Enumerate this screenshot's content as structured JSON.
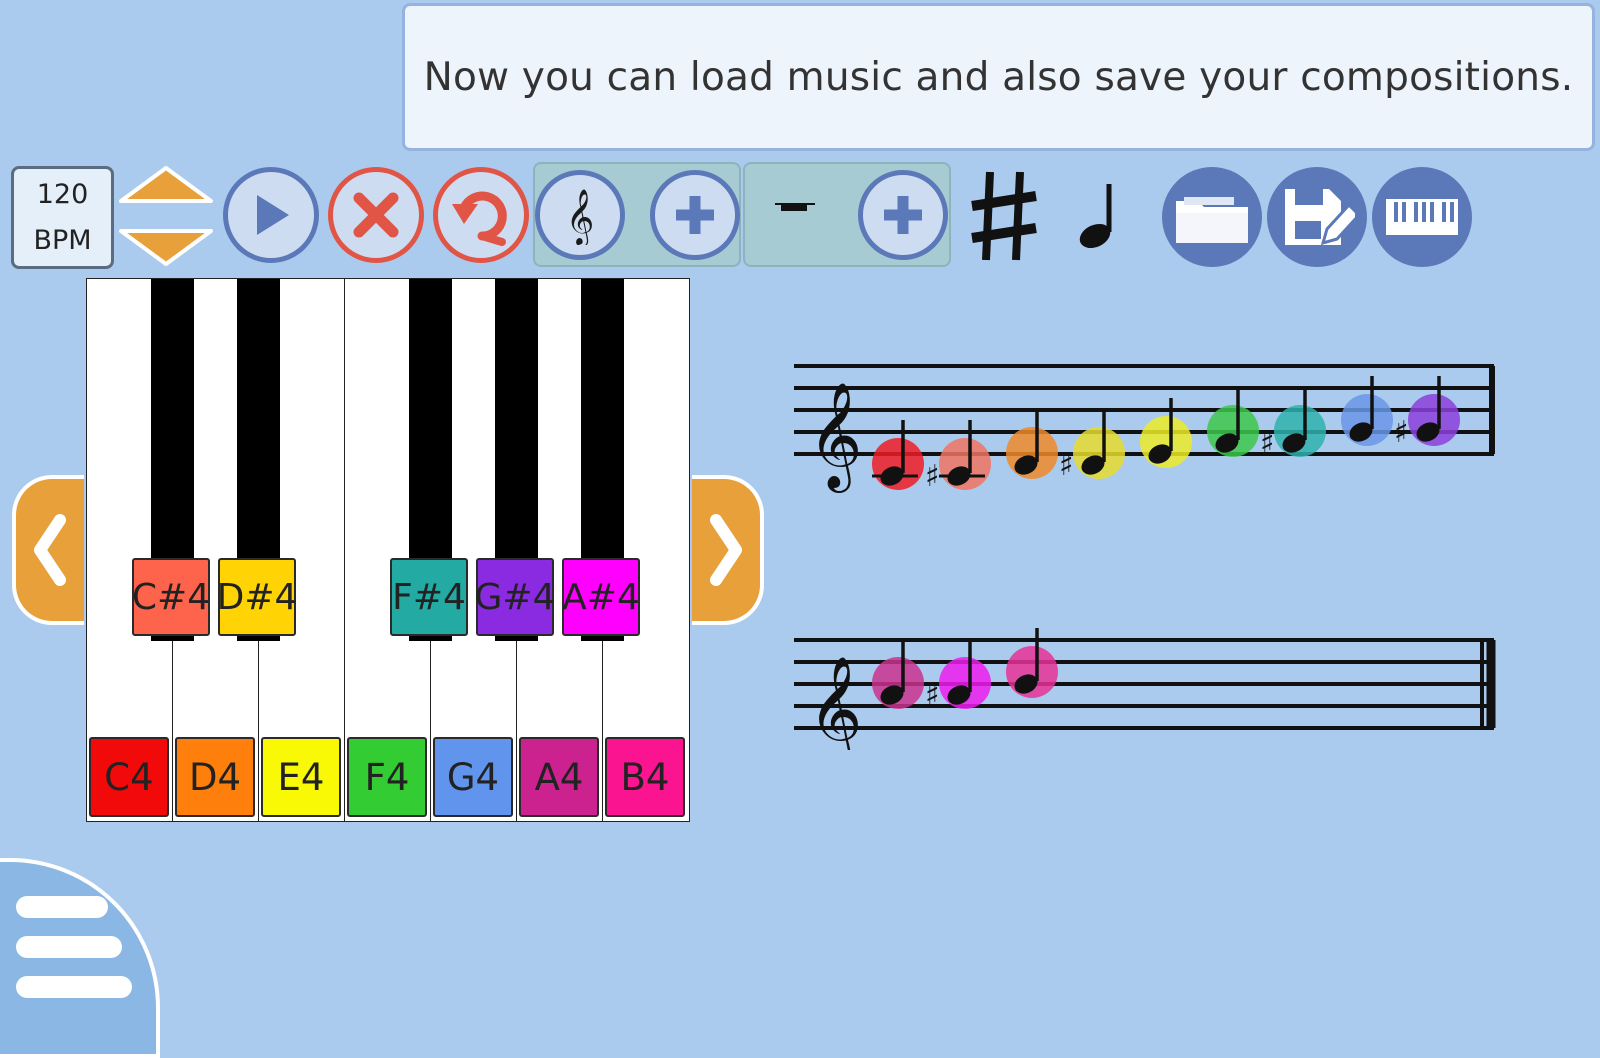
{
  "banner": {
    "message": "Now you can load music and also save your compositions."
  },
  "tempo": {
    "value": "120",
    "unit": "BPM"
  },
  "toolbar": {
    "tempo_up_icon": "triangle-up-icon",
    "tempo_down_icon": "triangle-down-icon",
    "play_icon": "play-icon",
    "clear_icon": "x-icon",
    "undo_icon": "undo-icon",
    "clef_icon": "treble-clef-icon",
    "add_clef_icon": "plus-icon",
    "rest_icon": "rest-icon",
    "add_rest_icon": "plus-icon",
    "sharp_icon": "sharp-icon",
    "note_icon": "quarter-note-icon",
    "load_icon": "folder-icon",
    "save_icon": "save-edit-icon",
    "keyboard_icon": "keyboard-icon"
  },
  "piano": {
    "white_keys": [
      {
        "label": "C4",
        "color": "#f20a0a"
      },
      {
        "label": "D4",
        "color": "#ff7f0d"
      },
      {
        "label": "E4",
        "color": "#f9f906"
      },
      {
        "label": "F4",
        "color": "#33cc33"
      },
      {
        "label": "G4",
        "color": "#6194ec"
      },
      {
        "label": "A4",
        "color": "#cc2290"
      },
      {
        "label": "B4",
        "color": "#fa1490"
      }
    ],
    "black_keys": [
      {
        "label": "C#4",
        "color": "#fe644b"
      },
      {
        "label": "D#4",
        "color": "#ffd304"
      },
      {
        "label": "F#4",
        "color": "#22aaa3"
      },
      {
        "label": "G#4",
        "color": "#8a2be2"
      },
      {
        "label": "A#4",
        "color": "#ff00fe"
      }
    ],
    "prev_icon": "chevron-left-icon",
    "next_icon": "chevron-right-icon"
  },
  "score": {
    "staff1_notes": [
      {
        "pitch": "C4",
        "sharp": false,
        "color": "#ee1c24"
      },
      {
        "pitch": "C#4",
        "sharp": true,
        "color": "#f07462"
      },
      {
        "pitch": "D4",
        "sharp": false,
        "color": "#ef8a28"
      },
      {
        "pitch": "D#4",
        "sharp": true,
        "color": "#e6dc2e"
      },
      {
        "pitch": "E4",
        "sharp": false,
        "color": "#ecec28"
      },
      {
        "pitch": "F4",
        "sharp": false,
        "color": "#3cc84a"
      },
      {
        "pitch": "F#4",
        "sharp": true,
        "color": "#2fb2ad"
      },
      {
        "pitch": "G4",
        "sharp": false,
        "color": "#6a96e6"
      },
      {
        "pitch": "G#4",
        "sharp": true,
        "color": "#8c3fdc"
      }
    ],
    "staff2_notes": [
      {
        "pitch": "A4",
        "sharp": false,
        "color": "#c9338d"
      },
      {
        "pitch": "A#4",
        "sharp": true,
        "color": "#ee1cee"
      },
      {
        "pitch": "B4",
        "sharp": false,
        "color": "#e63296"
      }
    ]
  },
  "menu": {
    "icon": "hamburger-menu-icon"
  }
}
